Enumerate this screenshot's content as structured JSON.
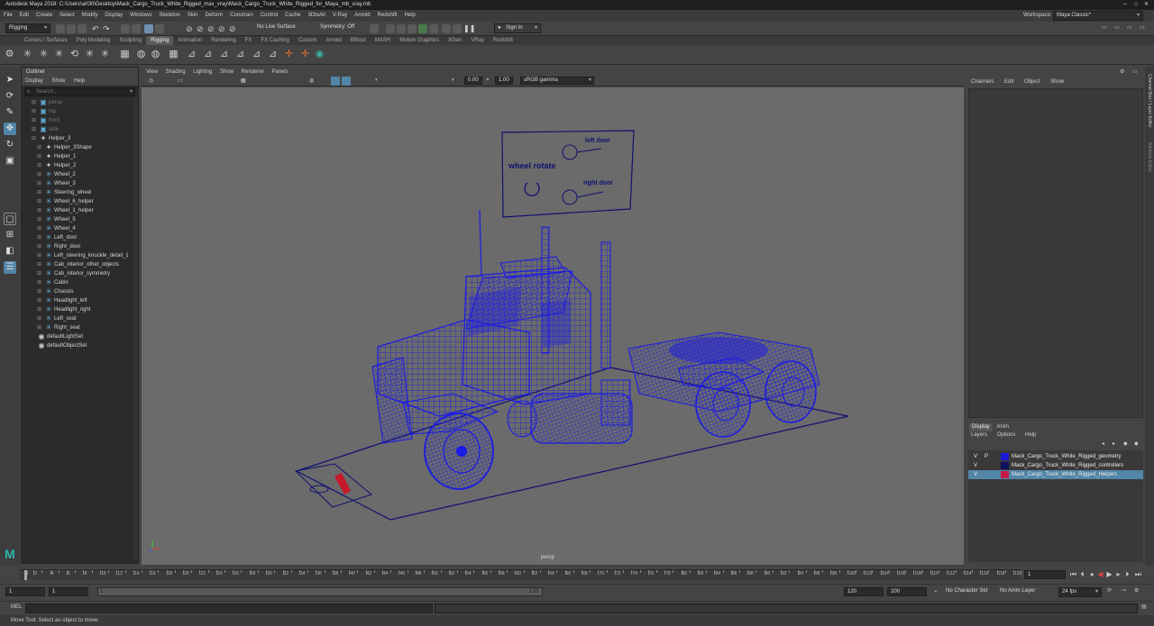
{
  "window": {
    "title": "Autodesk Maya 2018: C:\\Users\\art30\\Desktop\\Mack_Cargo_Truck_White_Rigged_max_vray\\Mack_Cargo_Truck_White_Rigged_for_Maya_mb_vray.mb"
  },
  "menubar": {
    "items": [
      "File",
      "Edit",
      "Create",
      "Select",
      "Modify",
      "Display",
      "Windows",
      "Skeleton",
      "Skin",
      "Deform",
      "Constrain",
      "Control",
      "Cache",
      "3DtoAll",
      "V-Ray",
      "Arnold",
      "Redshift",
      "Help"
    ],
    "workspace_label": "Workspace:",
    "workspace_value": "Maya Classic*"
  },
  "statusline": {
    "mode": "Rigging",
    "live_surface": "No Live Surface",
    "symmetry": "Symmetry: Off",
    "sign_in": "Sign In"
  },
  "shelf": {
    "tabs": [
      "Curves / Surfaces",
      "Poly Modeling",
      "Sculpting",
      "Rigging",
      "Animation",
      "Rendering",
      "FX",
      "FX Caching",
      "Custom",
      "Arnold",
      "Bifrost",
      "MASH",
      "Motion Graphics",
      "XGen",
      "VRay",
      "Redshift"
    ],
    "active": "Rigging"
  },
  "outliner": {
    "title": "Outliner",
    "menu": [
      "Display",
      "Show",
      "Help"
    ],
    "search_placeholder": "Search...",
    "items": [
      {
        "label": "persp",
        "icon": "camera-icon",
        "dim": true,
        "indent": 0
      },
      {
        "label": "top",
        "icon": "camera-icon",
        "dim": true,
        "indent": 0
      },
      {
        "label": "front",
        "icon": "camera-icon",
        "dim": true,
        "indent": 0
      },
      {
        "label": "side",
        "icon": "camera-icon",
        "dim": true,
        "indent": 0
      },
      {
        "label": "Helper_3",
        "icon": "locator-icon",
        "dim": false,
        "indent": 0,
        "expanded": true
      },
      {
        "label": "Helper_3Shape",
        "icon": "locator-icon",
        "dim": false,
        "indent": 1
      },
      {
        "label": "Helper_1",
        "icon": "locator-icon",
        "dim": false,
        "indent": 1
      },
      {
        "label": "Helper_2",
        "icon": "locator-icon",
        "dim": false,
        "indent": 1
      },
      {
        "label": "Wheel_2",
        "icon": "transform-icon",
        "dim": false,
        "indent": 1
      },
      {
        "label": "Wheel_3",
        "icon": "transform-icon",
        "dim": false,
        "indent": 1
      },
      {
        "label": "Steering_wheel",
        "icon": "transform-icon",
        "dim": false,
        "indent": 1
      },
      {
        "label": "Wheel_6_helper",
        "icon": "transform-icon",
        "dim": false,
        "indent": 1
      },
      {
        "label": "Wheel_1_helper",
        "icon": "transform-icon",
        "dim": false,
        "indent": 1
      },
      {
        "label": "Wheel_5",
        "icon": "transform-icon",
        "dim": false,
        "indent": 1
      },
      {
        "label": "Wheel_4",
        "icon": "transform-icon",
        "dim": false,
        "indent": 1
      },
      {
        "label": "Left_door",
        "icon": "transform-icon",
        "dim": false,
        "indent": 1
      },
      {
        "label": "Right_door",
        "icon": "transform-icon",
        "dim": false,
        "indent": 1
      },
      {
        "label": "Left_steering_knuckle_detail_1",
        "icon": "transform-icon",
        "dim": false,
        "indent": 1
      },
      {
        "label": "Cab_interior_other_objects",
        "icon": "transform-icon",
        "dim": false,
        "indent": 1
      },
      {
        "label": "Cab_interior_symmetry",
        "icon": "transform-icon",
        "dim": false,
        "indent": 1
      },
      {
        "label": "Cabin",
        "icon": "transform-icon",
        "dim": false,
        "indent": 1
      },
      {
        "label": "Chassis",
        "icon": "transform-icon",
        "dim": false,
        "indent": 1
      },
      {
        "label": "Headlight_left",
        "icon": "transform-icon",
        "dim": false,
        "indent": 1
      },
      {
        "label": "Headlight_right",
        "icon": "transform-icon",
        "dim": false,
        "indent": 1
      },
      {
        "label": "Left_seat",
        "icon": "transform-icon",
        "dim": false,
        "indent": 1
      },
      {
        "label": "Right_seat",
        "icon": "transform-icon",
        "dim": false,
        "indent": 1
      },
      {
        "label": "defaultLightSet",
        "icon": "set-icon",
        "dim": false,
        "indent": 0
      },
      {
        "label": "defaultObjectSet",
        "icon": "set-icon",
        "dim": false,
        "indent": 0
      }
    ]
  },
  "viewport": {
    "menu": [
      "View",
      "Shading",
      "Lighting",
      "Show",
      "Renderer",
      "Panels"
    ],
    "exposure": "0.00",
    "gamma": "1.00",
    "color_space": "sRGB gamma",
    "camera_label": "persp",
    "controls": {
      "left_door": "left door",
      "right_door": "right door",
      "wheel_rotate": "wheel rotate"
    }
  },
  "channelbox": {
    "menu": [
      "Channels",
      "Edit",
      "Object",
      "Show"
    ],
    "side_tabs": [
      "Channel Box / Layer Editor",
      "Attribute Editor"
    ]
  },
  "layers": {
    "tabs": [
      "Display",
      "Anim"
    ],
    "active": "Display",
    "menu": [
      "Layers",
      "Options",
      "Help"
    ],
    "rows": [
      {
        "v": "V",
        "p": "P",
        "name": "Mack_Cargo_Truck_White_Rigged_geometry",
        "color": "#1a1ad8",
        "selected": false
      },
      {
        "v": "V",
        "p": "",
        "name": "Mack_Cargo_Truck_White_Rigged_controllers",
        "color": "#101060",
        "selected": false
      },
      {
        "v": "V",
        "p": "",
        "name": "Mack_Cargo_Truck_White_Rigged_Helpers",
        "color": "#c41a4a",
        "selected": true
      }
    ]
  },
  "timeline": {
    "ticks": [
      "1",
      "2",
      "4",
      "6",
      "8",
      "10",
      "12",
      "14",
      "16",
      "18",
      "20",
      "22",
      "24",
      "26",
      "28",
      "30",
      "32",
      "34",
      "36",
      "38",
      "40",
      "42",
      "44",
      "46",
      "48",
      "50",
      "52",
      "54",
      "56",
      "58",
      "60",
      "62",
      "64",
      "66",
      "68",
      "70",
      "72",
      "74",
      "76",
      "78",
      "80",
      "82",
      "84",
      "86",
      "88",
      "90",
      "92",
      "94",
      "96",
      "98",
      "100",
      "102",
      "104",
      "106",
      "108",
      "110",
      "112",
      "114",
      "116",
      "118",
      "120"
    ],
    "current_frame": "1"
  },
  "range": {
    "start": "1",
    "anim_start": "1",
    "slider_start": "1",
    "slider_end": "120",
    "end": "120",
    "anim_end": "200",
    "character_set": "No Character Set",
    "anim_layer": "No Anim Layer",
    "fps": "24 fps"
  },
  "mel": {
    "label": "MEL"
  },
  "help_line": "Move Tool: Select an object to move.",
  "colors": {
    "wire": "#1a1ae6",
    "viewport_bg": "#6b6b6b",
    "selected_row": "#5285a6"
  }
}
